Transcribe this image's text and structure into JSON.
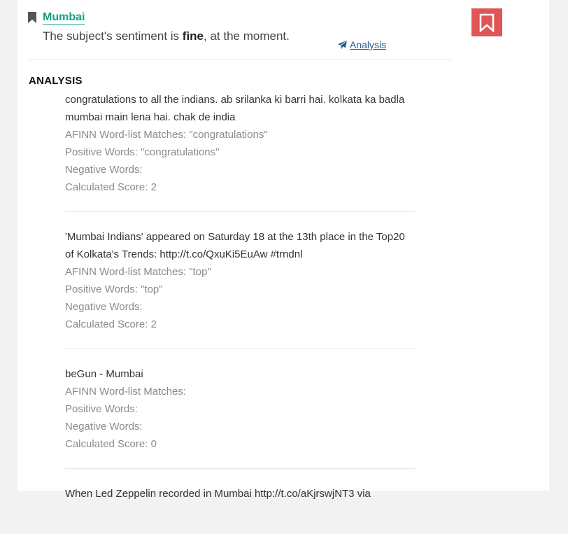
{
  "header": {
    "topic": "Mumbai",
    "sentiment_prefix": "The subject's sentiment is ",
    "sentiment_word": "fine",
    "sentiment_suffix": ", at the moment.",
    "analysis_link": "Analysis"
  },
  "section_title": "ANALYSIS",
  "labels": {
    "afinn": "AFINN Word-list Matches: ",
    "positive": "Positive Words: ",
    "negative": "Negative Words: ",
    "score": "Calculated Score: "
  },
  "entries": [
    {
      "text": "congratulations to all the indians. ab srilanka ki barri hai. kolkata ka badla mumbai main lena hai. chak de india",
      "afinn": "\"congratulations\"",
      "positive": "\"congratulations\"",
      "negative": "",
      "score": "2"
    },
    {
      "text": "'Mumbai Indians' appeared on Saturday 18 at the 13th place in the Top20 of Kolkata's Trends: http://t.co/QxuKi5EuAw #trndnl",
      "afinn": "\"top\"",
      "positive": "\"top\"",
      "negative": "",
      "score": "2"
    },
    {
      "text": "beGun - Mumbai",
      "afinn": "",
      "positive": "",
      "negative": "",
      "score": "0"
    },
    {
      "text": "When Led Zeppelin recorded in Mumbai http://t.co/aKjrswjNT3 via"
    }
  ],
  "colors": {
    "accent": "#16a085",
    "bookmark_bg": "#e05555",
    "link": "#2c5a8c"
  },
  "icons": {
    "topic": "bookmark-icon",
    "analysis": "paper-plane-icon",
    "bookmark_button": "bookmark-outline-icon"
  }
}
